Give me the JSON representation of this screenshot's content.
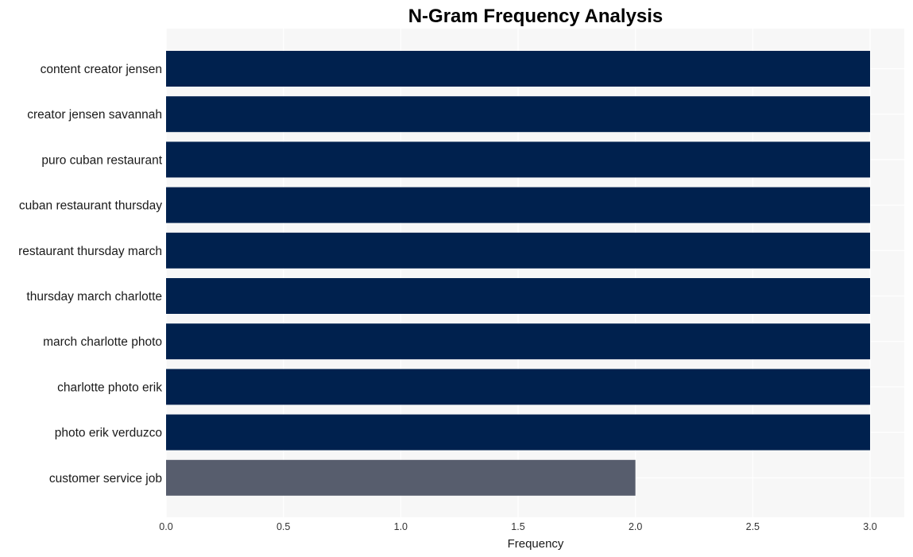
{
  "chart_data": {
    "type": "bar",
    "orientation": "horizontal",
    "title": "N-Gram Frequency Analysis",
    "xlabel": "Frequency",
    "ylabel": "",
    "xlim": [
      0,
      3.15
    ],
    "xticks": [
      0.0,
      0.5,
      1.0,
      1.5,
      2.0,
      2.5,
      3.0
    ],
    "xtick_labels": [
      "0.0",
      "0.5",
      "1.0",
      "1.5",
      "2.0",
      "2.5",
      "3.0"
    ],
    "grid": true,
    "categories": [
      "content creator jensen",
      "creator jensen savannah",
      "puro cuban restaurant",
      "cuban restaurant thursday",
      "restaurant thursday march",
      "thursday march charlotte",
      "march charlotte photo",
      "charlotte photo erik",
      "photo erik verduzco",
      "customer service job"
    ],
    "values": [
      3,
      3,
      3,
      3,
      3,
      3,
      3,
      3,
      3,
      2
    ],
    "colors": {
      "max_bar": "#00214e",
      "other_bar": "#575d6d",
      "panel_bg": "#f7f7f7",
      "grid": "#ffffff"
    }
  }
}
